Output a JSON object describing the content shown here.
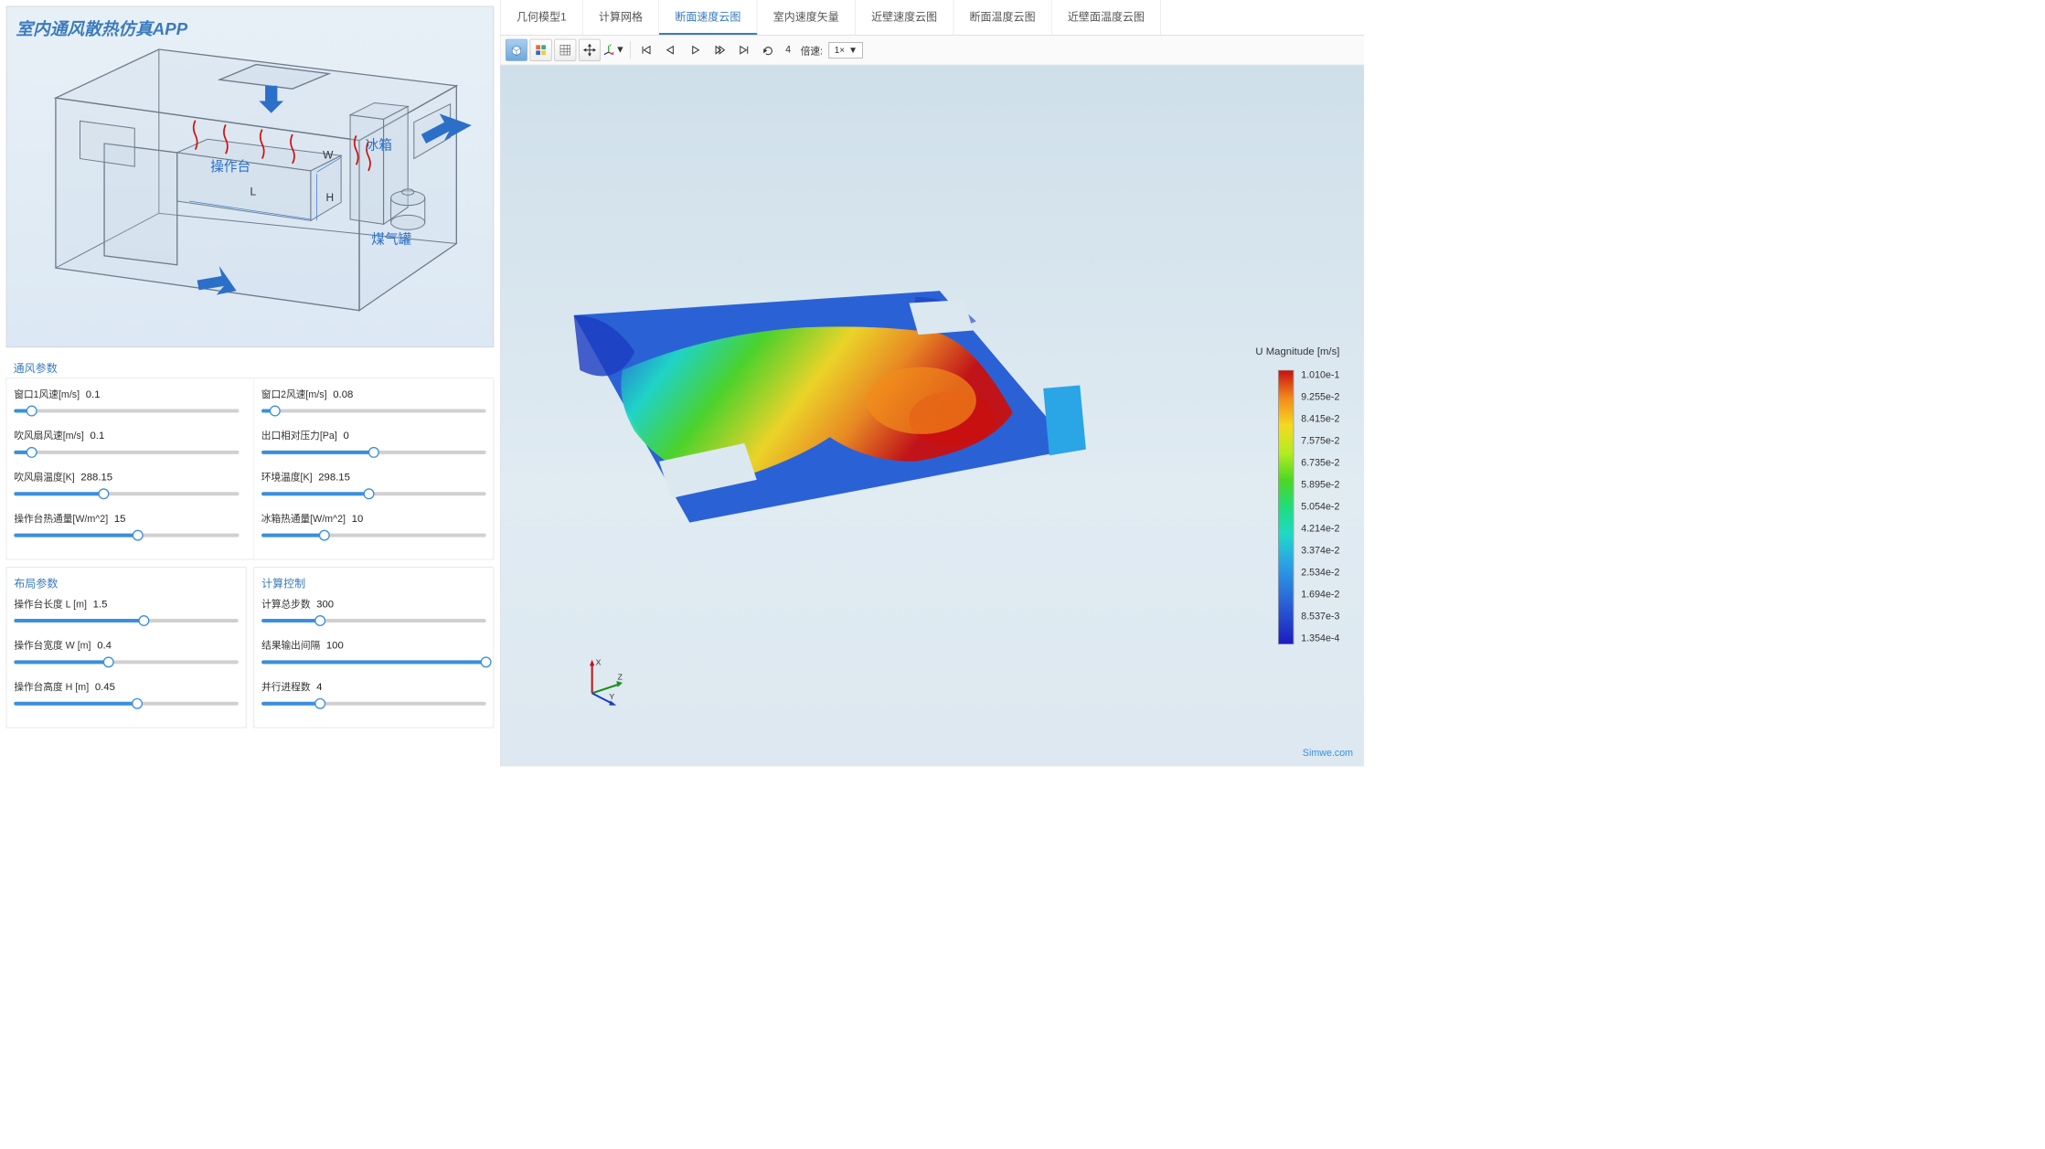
{
  "app": {
    "title": "室内通风散热仿真APP"
  },
  "diagram": {
    "label_table": "操作台",
    "label_fridge": "冰箱",
    "label_gas": "煤气罐",
    "dim_L": "L",
    "dim_W": "W",
    "dim_H": "H"
  },
  "sections": {
    "ventilation": "通风参数",
    "layout": "布局参数",
    "compute": "计算控制"
  },
  "ventilation": [
    {
      "label": "窗口1风速[m/s]",
      "value": "0.1",
      "pct": 8
    },
    {
      "label": "窗口2风速[m/s]",
      "value": "0.08",
      "pct": 6
    },
    {
      "label": "吹风扇风速[m/s]",
      "value": "0.1",
      "pct": 8
    },
    {
      "label": "出口相对压力[Pa]",
      "value": "0",
      "pct": 50
    },
    {
      "label": "吹风扇温度[K]",
      "value": "288.15",
      "pct": 40
    },
    {
      "label": "环境温度[K]",
      "value": "298.15",
      "pct": 48
    },
    {
      "label": "操作台热通量[W/m^2]",
      "value": "15",
      "pct": 55
    },
    {
      "label": "冰箱热通量[W/m^2]",
      "value": "10",
      "pct": 28
    }
  ],
  "layout": [
    {
      "label": "操作台长度 L [m]",
      "value": "1.5",
      "pct": 58
    },
    {
      "label": "操作台宽度 W [m]",
      "value": "0.4",
      "pct": 42
    },
    {
      "label": "操作台高度 H [m]",
      "value": "0.45",
      "pct": 55
    }
  ],
  "compute": [
    {
      "label": "计算总步数",
      "value": "300",
      "pct": 26
    },
    {
      "label": "结果输出间隔",
      "value": "100",
      "pct": 100
    },
    {
      "label": "并行进程数",
      "value": "4",
      "pct": 26
    }
  ],
  "tabs": [
    "几何模型1",
    "计算网格",
    "断面速度云图",
    "室内速度矢量",
    "近壁速度云图",
    "断面温度云图",
    "近壁面温度云图"
  ],
  "tab_active": 2,
  "toolbar": {
    "frame_num": "4",
    "speed_label": "倍速:",
    "speed_value": "1×"
  },
  "legend": {
    "title": "U Magnitude [m/s]",
    "ticks": [
      "1.010e-1",
      "9.255e-2",
      "8.415e-2",
      "7.575e-2",
      "6.735e-2",
      "5.895e-2",
      "5.054e-2",
      "4.214e-2",
      "3.374e-2",
      "2.534e-2",
      "1.694e-2",
      "8.537e-3",
      "1.354e-4"
    ]
  },
  "axes": {
    "x": "X",
    "y": "Y",
    "z": "Z"
  },
  "watermark": "Simwe.com",
  "chart_data": {
    "type": "heatmap",
    "title": "断面速度云图 (velocity magnitude contour on section plane)",
    "variable": "U Magnitude",
    "unit": "m/s",
    "range_min": 0.0001354,
    "range_max": 0.101,
    "colormap": "jet",
    "description": "Y-shaped high-velocity region (orange/red ~0.08–0.10 m/s) across room floor plane, surrounded by lower velocity blue/green regions (~0.001–0.03 m/s). Peak near fridge corner, two rectangular cutouts for table and vent."
  }
}
